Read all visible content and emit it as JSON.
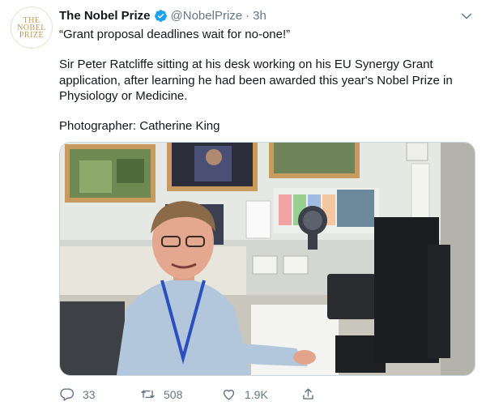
{
  "author": {
    "avatar_logo": [
      "THE",
      "NOBEL",
      "PRIZE"
    ],
    "name": "The Nobel Prize",
    "verified_icon": "verified-badge-icon",
    "handle": "@NobelPrize",
    "separator": "·",
    "time": "3h"
  },
  "tweet": {
    "line1": "“Grant proposal deadlines wait for no-one!”",
    "line2": "Sir Peter Ratcliffe sitting at his desk working on his EU Synergy Grant application, after learning he had been awarded this year's Nobel Prize in Physiology or Medicine.",
    "line3": "Photographer: Catherine King"
  },
  "actions": {
    "reply_count": "33",
    "retweet_count": "508",
    "like_count": "1.9K",
    "icons": [
      "reply-icon",
      "retweet-icon",
      "like-icon",
      "share-icon"
    ]
  },
  "colors": {
    "brand_gold": "#c39a5a",
    "verified_blue": "#1da1f2",
    "muted": "#657786"
  }
}
